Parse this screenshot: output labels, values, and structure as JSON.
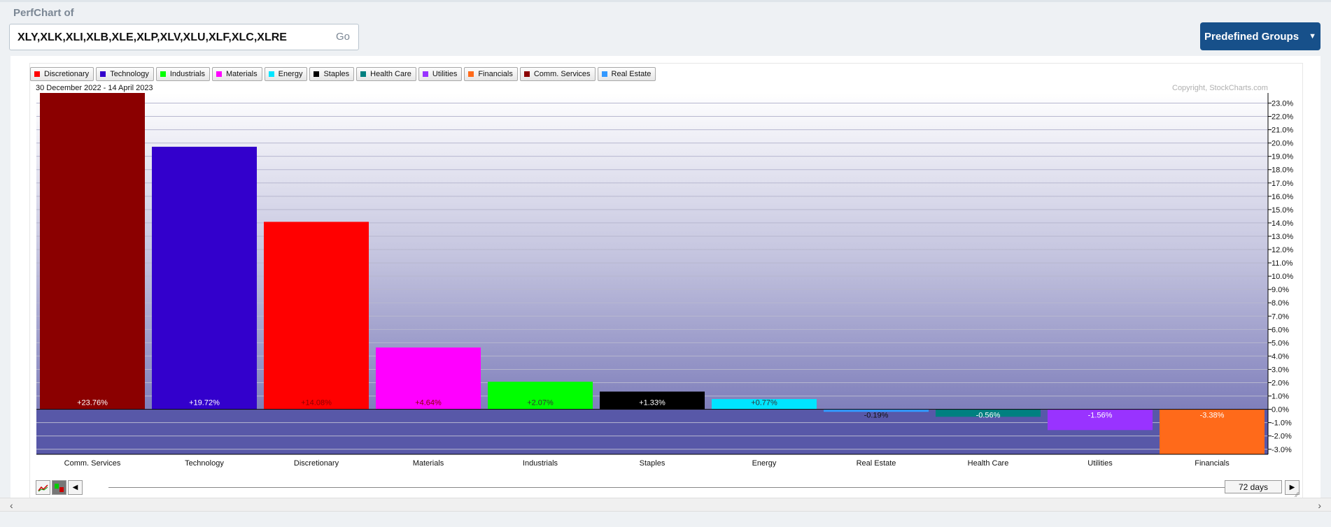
{
  "header": {
    "title": "PerfChart of",
    "symbols_value": "XLY,XLK,XLI,XLB,XLE,XLP,XLV,XLU,XLF,XLC,XLRE",
    "go_label": "Go",
    "groups_label": "Predefined Groups"
  },
  "legend": [
    {
      "label": "Discretionary",
      "color": "#ff0000"
    },
    {
      "label": "Technology",
      "color": "#3300cc"
    },
    {
      "label": "Industrials",
      "color": "#00ff00"
    },
    {
      "label": "Materials",
      "color": "#ff00ff"
    },
    {
      "label": "Energy",
      "color": "#00e5ff"
    },
    {
      "label": "Staples",
      "color": "#000000"
    },
    {
      "label": "Health Care",
      "color": "#008080"
    },
    {
      "label": "Utilities",
      "color": "#9933ff"
    },
    {
      "label": "Financials",
      "color": "#ff6a1a"
    },
    {
      "label": "Comm. Services",
      "color": "#8b0000"
    },
    {
      "label": "Real Estate",
      "color": "#3399ff"
    }
  ],
  "date_range": "30 December 2022 - 14 April 2023",
  "copyright": "Copyright, StockCharts.com",
  "controls": {
    "period_label": "72 days"
  },
  "chart_data": {
    "type": "bar",
    "categories": [
      "Comm. Services",
      "Technology",
      "Discretionary",
      "Materials",
      "Industrials",
      "Staples",
      "Energy",
      "Real Estate",
      "Health Care",
      "Utilities",
      "Financials"
    ],
    "values": [
      23.76,
      19.72,
      14.08,
      4.64,
      2.07,
      1.33,
      0.77,
      -0.19,
      -0.56,
      -1.56,
      -3.38
    ],
    "labels": [
      "+23.76%",
      "+19.72%",
      "+14.08%",
      "+4.64%",
      "+2.07%",
      "+1.33%",
      "+0.77%",
      "-0.19%",
      "-0.56%",
      "-1.56%",
      "-3.38%"
    ],
    "colors": [
      "#8b0000",
      "#3300cc",
      "#ff0000",
      "#ff00ff",
      "#00ff00",
      "#000000",
      "#00e5ff",
      "#3399ff",
      "#008080",
      "#9933ff",
      "#ff6a1a"
    ],
    "label_colors": [
      "#ffffff",
      "#ffffff",
      "#8b0000",
      "#8b0000",
      "#333333",
      "#ffffff",
      "#333333",
      "#111111",
      "#ffffff",
      "#ffffff",
      "#ffffff"
    ],
    "y_ticks": [
      "23.0%",
      "22.0%",
      "21.0%",
      "20.0%",
      "19.0%",
      "18.0%",
      "17.0%",
      "16.0%",
      "15.0%",
      "14.0%",
      "13.0%",
      "12.0%",
      "11.0%",
      "10.0%",
      "9.0%",
      "8.0%",
      "7.0%",
      "6.0%",
      "5.0%",
      "4.0%",
      "3.0%",
      "2.0%",
      "1.0%",
      "0.0%",
      "-1.0%",
      "-2.0%",
      "-3.0%"
    ],
    "ylim": [
      -3.38,
      23.76
    ],
    "grid": true
  }
}
